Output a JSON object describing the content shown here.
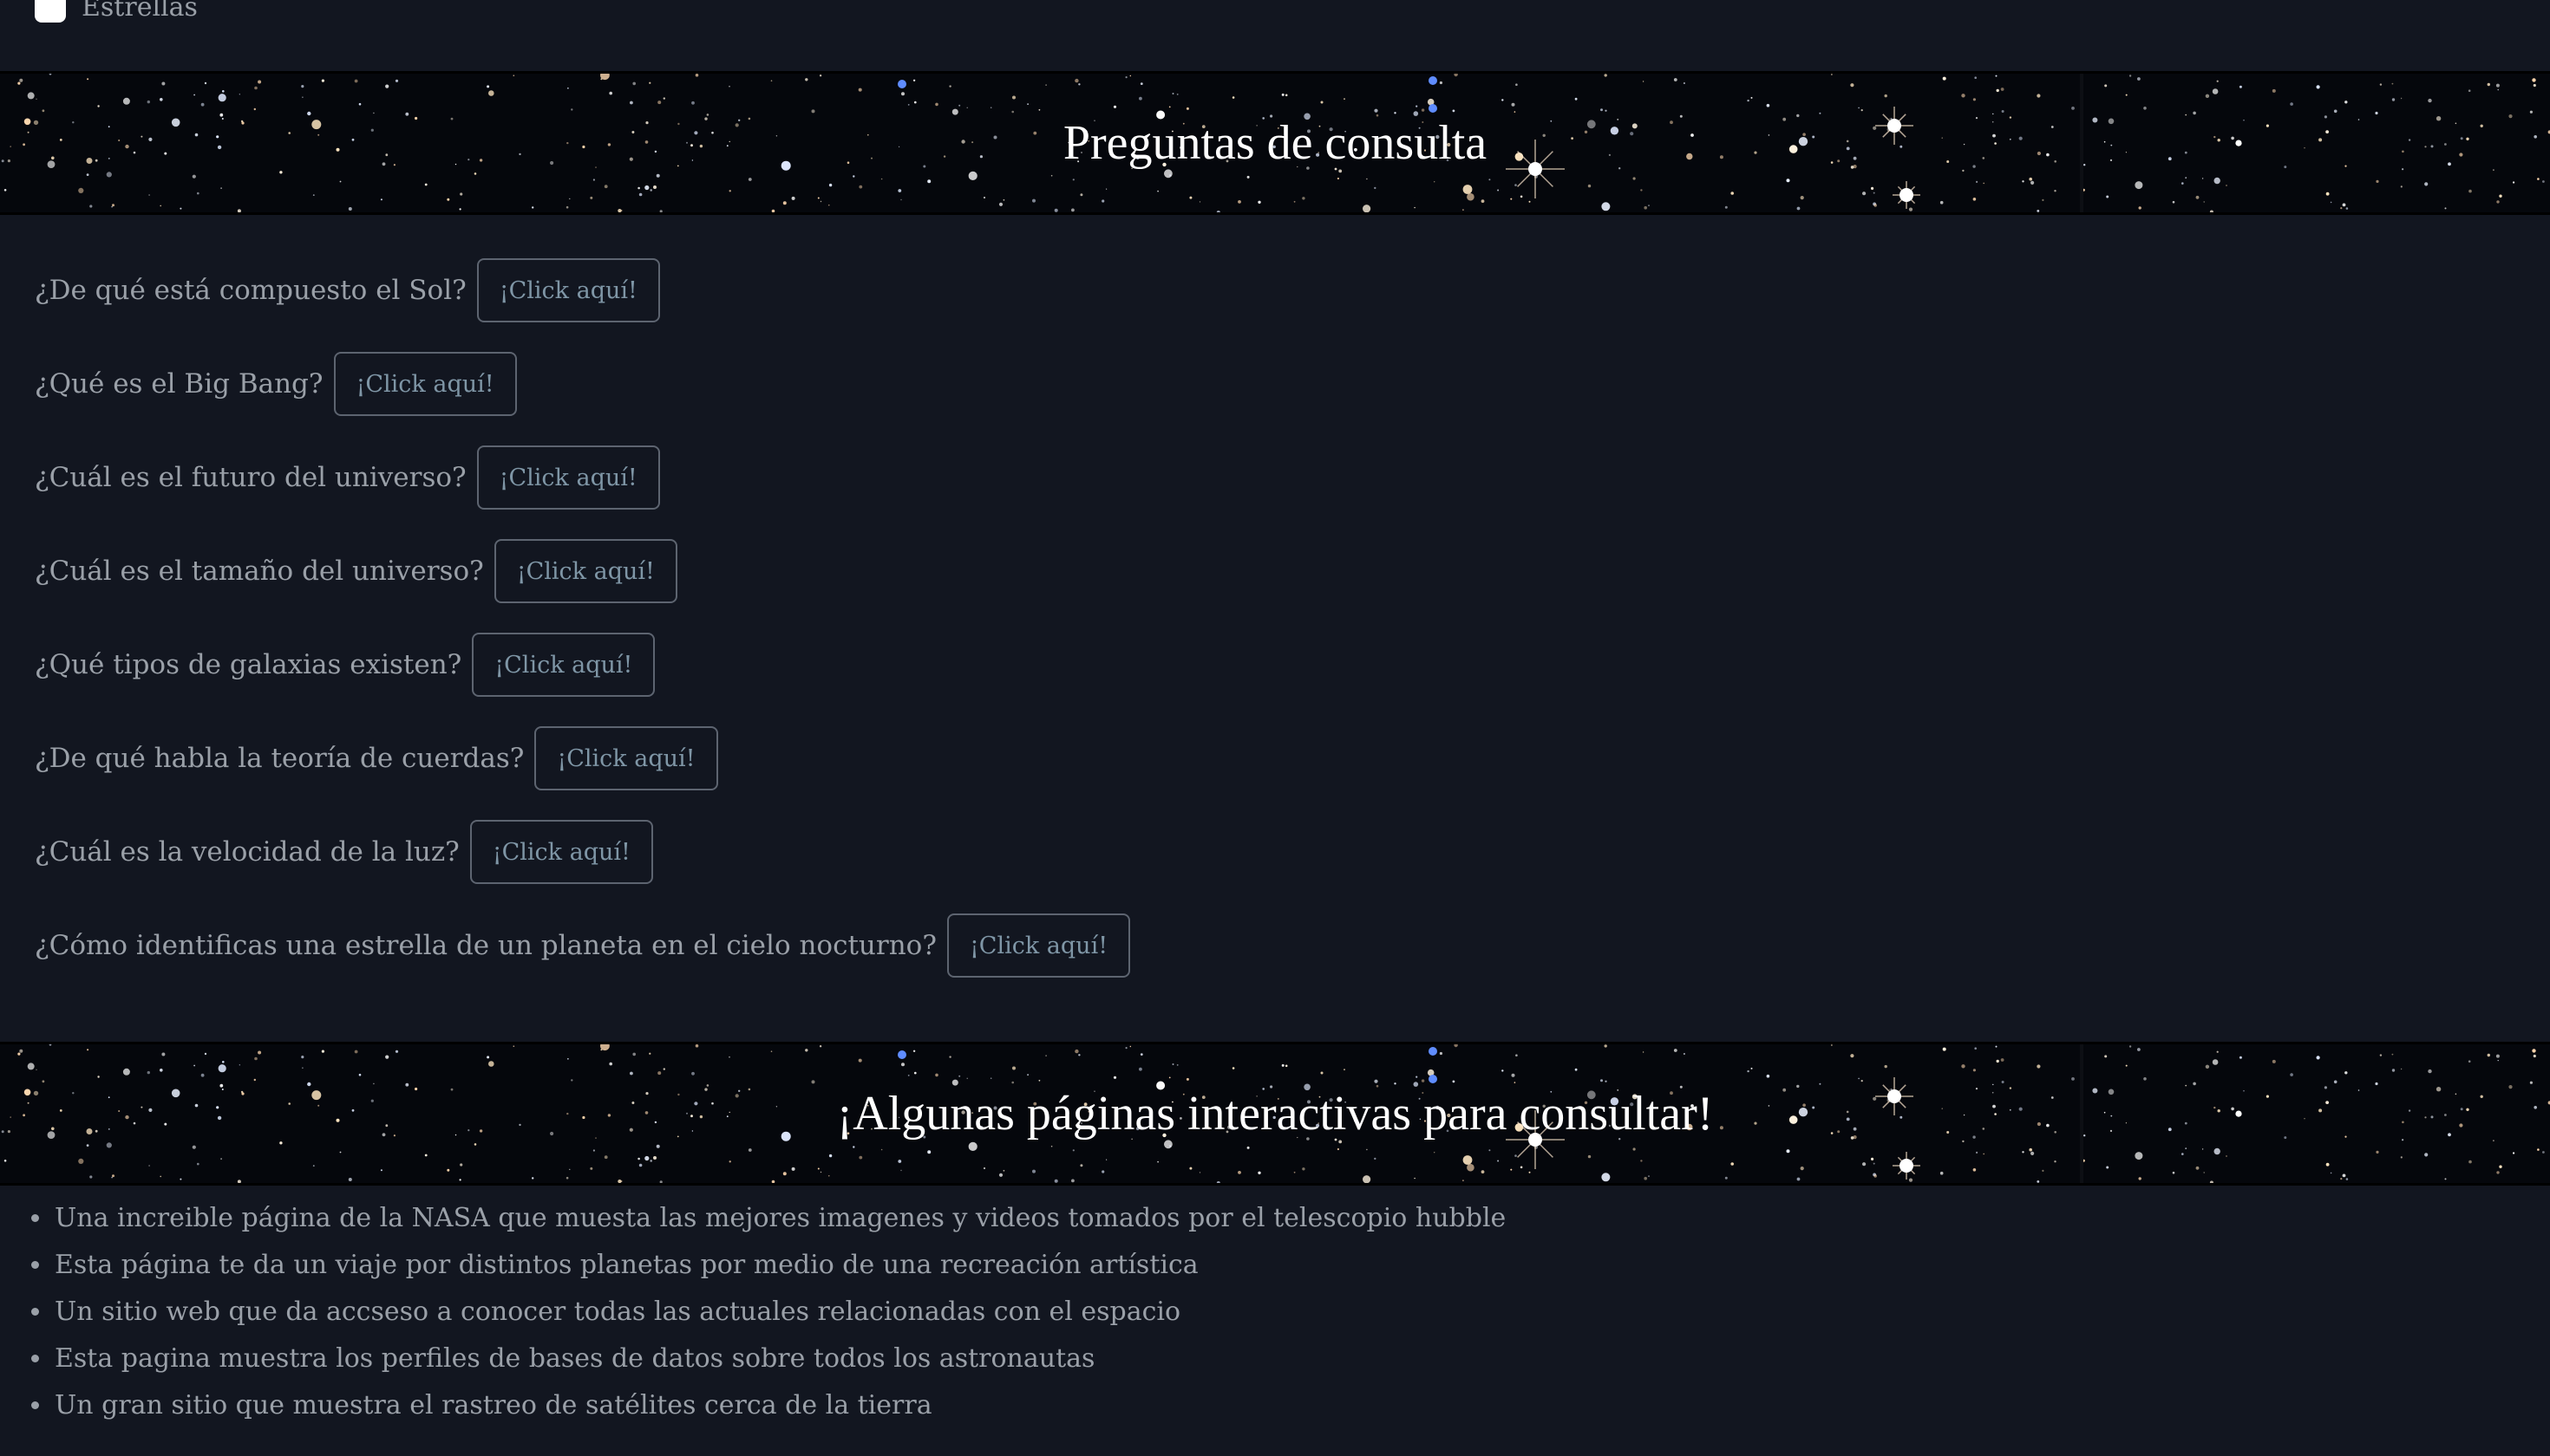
{
  "filter": {
    "label": "Estrellas"
  },
  "sections": {
    "questions_title": "Preguntas de consulta",
    "links_title": "¡Algunas páginas interactivas para consultar!"
  },
  "questions": [
    {
      "text": "¿De qué está compuesto el Sol?",
      "button": "¡Click aquí!"
    },
    {
      "text": "¿Qué es el Big Bang?",
      "button": "¡Click aquí!"
    },
    {
      "text": "¿Cuál es el futuro del universo?",
      "button": "¡Click aquí!"
    },
    {
      "text": "¿Cuál es el tamaño del universo?",
      "button": "¡Click aquí!"
    },
    {
      "text": "¿Qué tipos de galaxias existen?",
      "button": "¡Click aquí!"
    },
    {
      "text": "¿De qué habla la teoría de cuerdas?",
      "button": "¡Click aquí!"
    },
    {
      "text": "¿Cuál es la velocidad de la luz?",
      "button": "¡Click aquí!"
    },
    {
      "text": "¿Cómo identificas una estrella de un planeta en el cielo nocturno?",
      "button": "¡Click aquí!"
    }
  ],
  "links": [
    "Una increible página de la NASA que muesta las mejores imagenes y videos tomados por el telescopio hubble",
    "Esta página te da un viaje por distintos planetas por medio de una recreación artística",
    "Un sitio web que da accseso a conocer todas las actuales relacionadas con el espacio",
    "Esta pagina muestra los perfiles de bases de datos sobre todos los astronautas",
    "Un gran sitio que muestra el rastreo de satélites cerca de la tierra"
  ],
  "colors": {
    "background": "#121620",
    "text": "#9aa0a8",
    "button_text": "#7f96a6",
    "button_border": "#5d6470",
    "banner_bg": "#05070c",
    "banner_title": "#ffffff"
  },
  "icons": {
    "checkbox": "checkbox-icon",
    "bullet": "bullet-icon"
  }
}
